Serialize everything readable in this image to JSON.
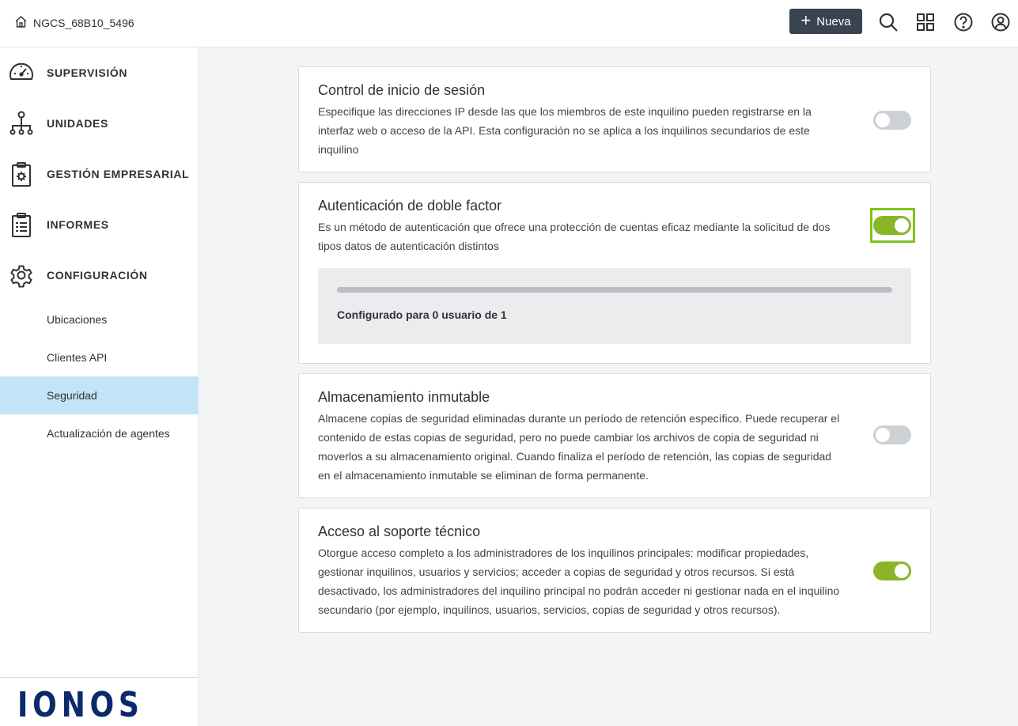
{
  "header": {
    "tenant_name": "NGCS_68B10_5496",
    "new_button_label": "Nueva",
    "icons": [
      "search-icon",
      "apps-grid-icon",
      "help-icon",
      "user-account-icon"
    ]
  },
  "sidebar": {
    "nav_items": [
      {
        "label": "SUPERVISIÓN",
        "icon": "speedometer-icon"
      },
      {
        "label": "UNIDADES",
        "icon": "org-tree-icon"
      },
      {
        "label": "GESTIÓN EMPRESARIAL",
        "icon": "clipboard-gear-icon"
      },
      {
        "label": "INFORMES",
        "icon": "report-icon"
      },
      {
        "label": "CONFIGURACIÓN",
        "icon": "gear-icon"
      }
    ],
    "sub_items": [
      {
        "label": "Ubicaciones",
        "active": false
      },
      {
        "label": "Clientes API",
        "active": false
      },
      {
        "label": "Seguridad",
        "active": true
      },
      {
        "label": "Actualización de agentes",
        "active": false
      }
    ],
    "logo_text": "IONOS"
  },
  "cards": [
    {
      "title": "Control de inicio de sesión",
      "description": "Especifique las direcciones IP desde las que los miembros de este inquilino pueden registrarse en la interfaz web o acceso de la API. Esta configuración no se aplica a los inquilinos secundarios de este inquilino",
      "enabled": false
    },
    {
      "title": "Autenticación de doble factor",
      "description": "Es un método de autenticación que ofrece una protección de cuentas eficaz mediante la solicitud de dos tipos datos de autenticación distintos",
      "enabled": true,
      "status_text": "Configurado para 0 usuario de 1",
      "progress_fraction": 0
    },
    {
      "title": "Almacenamiento inmutable",
      "description": "Almacene copias de seguridad eliminadas durante un período de retención específico. Puede recuperar el contenido de estas copias de seguridad, pero no puede cambiar los archivos de copia de seguridad ni moverlos a su almacenamiento original. Cuando finaliza el período de retención, las copias de seguridad en el almacenamiento inmutable se eliminan de forma permanente.",
      "enabled": false
    },
    {
      "title": "Acceso al soporte técnico",
      "description": "Otorgue acceso completo a los administradores de los inquilinos principales: modificar propiedades, gestionar inquilinos, usuarios y servicios; acceder a copias de seguridad y otros recursos. Si está desactivado, los administradores del inquilino principal no podrán acceder ni gestionar nada en el inquilino secundario (por ejemplo, inquilinos, usuarios, servicios, copias de seguridad y otros recursos).",
      "enabled": true
    }
  ],
  "colors": {
    "toggle_on": "#8bb528",
    "toggle_off": "#cdd0d4",
    "focus_ring": "#7fc31c",
    "active_nav": "#c3e4f7",
    "button_dark": "#3a4352",
    "logo": "#0b2a6b"
  }
}
